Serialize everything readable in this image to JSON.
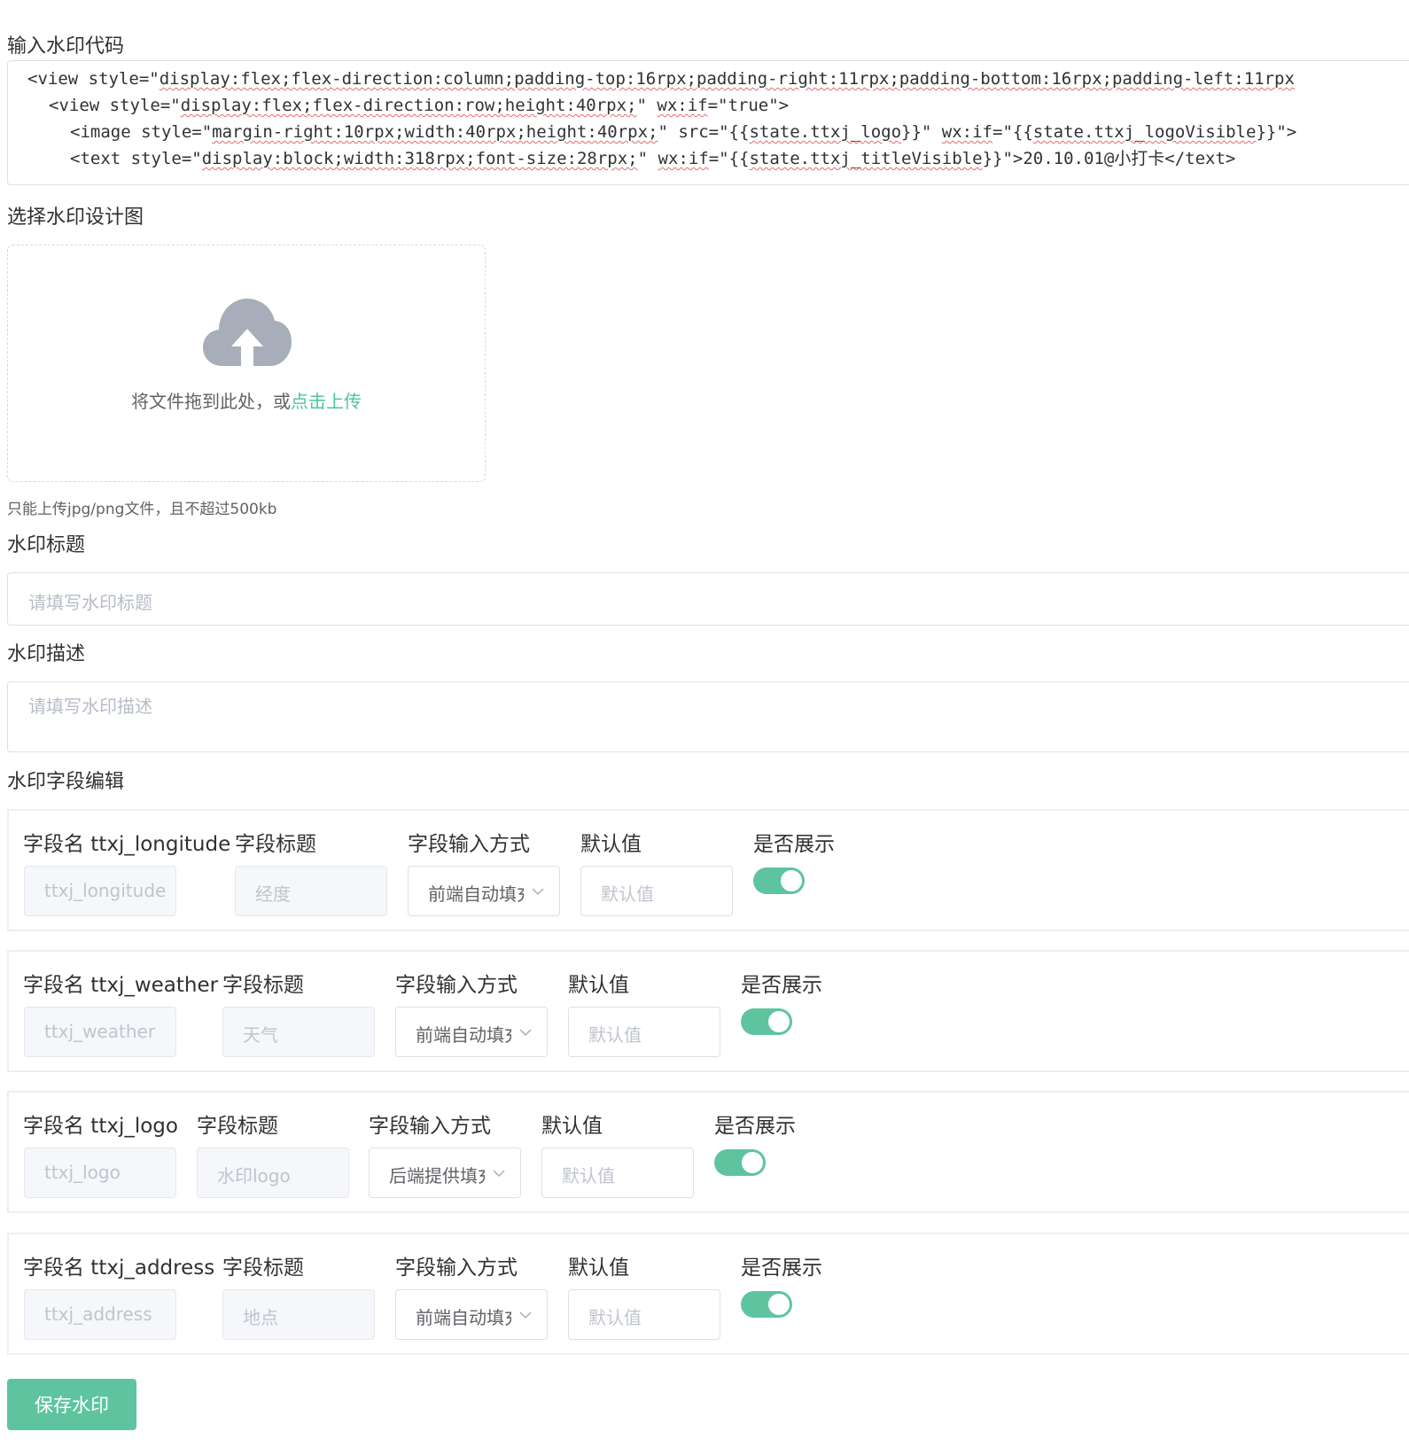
{
  "code_section": {
    "label": "输入水印代码",
    "lines": [
      {
        "p1": "<view style=\"",
        "s1": "display:flex;flex-direction:column;padding-top:16rpx;padding-right:11rpx;padding-bottom:16rpx;padding-left:11rpx",
        "p2": "",
        "s2": "",
        "p3": ""
      },
      {
        "p1": "<view style=\"",
        "s1": "display:flex;flex-direction:row;height:40rpx;",
        "p2": "\" ",
        "s2": "wx:if",
        "p3": "=\"true\">"
      },
      {
        "p1": "<image style=\"",
        "s1": "margin-right:10rpx;width:40rpx;height:40rpx;",
        "p2": "\" src=\"{{",
        "s2": "state.ttxj_logo",
        "p3": "}}\" ",
        "s3": "wx:if",
        "p4": "=\"{{",
        "s4": "state.ttxj_logoVisible",
        "p5": "}}\">"
      },
      {
        "p1": "<text style=\"",
        "s1": "display:block;width:318rpx;font-size:28rpx;",
        "p2": "\" ",
        "s2": "wx:if",
        "p3": "=\"{{",
        "s3": "state.ttxj_titleVisible",
        "p4": "}}\">20.10.01@小打卡</text>"
      }
    ]
  },
  "design_section": {
    "label": "选择水印设计图",
    "upload_text": "将文件拖到此处，或",
    "upload_link": "点击上传",
    "tip": "只能上传jpg/png文件，且不超过500kb"
  },
  "title_section": {
    "label": "水印标题",
    "placeholder": "请填写水印标题"
  },
  "desc_section": {
    "label": "水印描述",
    "placeholder": "请填写水印描述"
  },
  "fields_section": {
    "label": "水印字段编辑",
    "col_title": "字段标题",
    "col_input_method": "字段输入方式",
    "col_default": "默认值",
    "col_show": "是否展示",
    "default_placeholder": "默认值",
    "fields": [
      {
        "name_label": "字段名 ttxj_longitude",
        "name_value": "ttxj_longitude",
        "title_value": "经度",
        "method": "前端自动填充",
        "visible": true
      },
      {
        "name_label": "字段名 ttxj_weather",
        "name_value": "ttxj_weather",
        "title_value": "天气",
        "method": "前端自动填充",
        "visible": true
      },
      {
        "name_label": "字段名 ttxj_logo",
        "name_value": "ttxj_logo",
        "title_value": "水印logo",
        "method": "后端提供填充",
        "visible": true
      },
      {
        "name_label": "字段名 ttxj_address",
        "name_value": "ttxj_address",
        "title_value": "地点",
        "method": "前端自动填充",
        "visible": true
      }
    ]
  },
  "actions": {
    "save_label": "保存水印"
  },
  "colors": {
    "accent": "#5ec4a0",
    "link": "#4cc3a0",
    "border": "#dcdfe6",
    "placeholder": "#b7bcc6"
  }
}
